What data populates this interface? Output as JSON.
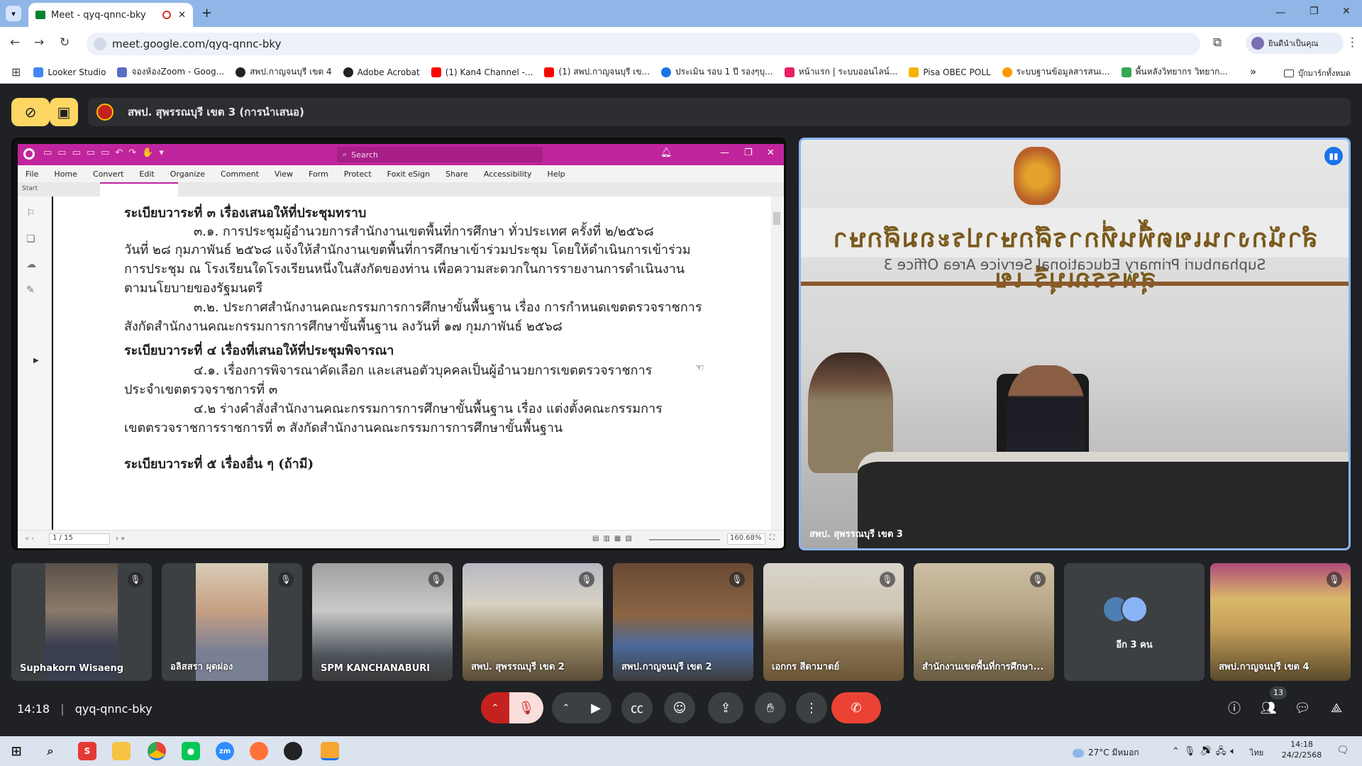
{
  "browser": {
    "tab_title": "Meet - qyq-qnnc-bky",
    "new_tab": "+",
    "url": "meet.google.com/qyq-qnnc-bky",
    "profile_label": "ยินดีนำเป็นคุณ",
    "bookmarks": [
      "Looker Studio",
      "จองห้องZoom - Goog...",
      "สพป.กาญจนบุรี เขต 4",
      "Adobe Acrobat",
      "(1) Kan4 Channel -...",
      "(1) สพป.กาญจนบุรี เข...",
      "ประเมิน รอบ 1 ปี รองๆบุ...",
      "หน้าแรก | ระบบออนไลน์...",
      "Pisa OBEC POLL",
      "ระบบฐานข้อมูลสารสนเ...",
      "พื้นหลังวิทยากร วิทยาก..."
    ],
    "bookmarks_more": "»",
    "other_bookmarks": "บุ๊กมาร์กทั้งหมด"
  },
  "meet": {
    "presenter_title": "สพป. สุพรรณบุรี เขต 3 (การนำเสนอ)",
    "speaker_name": "สพป. สุพรรณบุรี เขต 3",
    "sign_text": "สำนักงานเขตพื้นที่การศึกษาประถมศึกษาสุพรรณบุรี เข",
    "sign_sub": "Suphanburi Primary Educational Service Area Office 3",
    "participants": [
      "Suphakorn Wisaeng",
      "อลิสสรา ผุดผ่อง",
      "SPM KANCHANABURI",
      "สพป. สุพรรณบุรี เขต 2",
      "สพป.กาญจนบุรี เขต 2",
      "เอกกร สีดามาตย์",
      "สำนักงานเขตพื้นที่การศึกษา...",
      "อีก 3 คน",
      "สพป.กาญจนบุรี เขต 4"
    ],
    "time": "14:18",
    "meeting_code": "qyq-qnnc-bky",
    "people_count": "13"
  },
  "foxit": {
    "search_placeholder": "Search",
    "menu": [
      "File",
      "Home",
      "Convert",
      "Edit",
      "Organize",
      "Comment",
      "View",
      "Form",
      "Protect",
      "Foxit eSign",
      "Share",
      "Accessibility",
      "Help"
    ],
    "tab_start": "Start",
    "page": "1 / 15",
    "zoom": "160.68%",
    "doc_lines": [
      "ระเบียบวาระที่ ๓ เรื่องเสนอให้ที่ประชุมทราบ",
      "๓.๑. การประชุมผู้อำนวยการสำนักงานเขตพื้นที่การศึกษา ทั่วประเทศ ครั้งที่ ๒/๒๕๖๘",
      "วันที่ ๒๘ กุมภาพันธ์ ๒๕๖๘ แจ้งให้สำนักงานเขตพื้นที่การศึกษาเข้าร่วมประชุม โดยให้ดำเนินการเข้าร่วม",
      "การประชุม ณ โรงเรียนใดโรงเรียนหนึ่งในสังกัดของท่าน เพื่อความสะดวกในการรายงานการดำเนินงาน",
      "ตามนโยบายของรัฐมนตรี",
      "๓.๒. ประกาศสำนักงานคณะกรรมการการศึกษาขั้นพื้นฐาน เรื่อง การกำหนดเขตตรวจราชการ",
      "สังกัดสำนักงานคณะกรรมการการศึกษาขั้นพื้นฐาน ลงวันที่ ๑๗ กุมภาพันธ์ ๒๕๖๘",
      "ระเบียบวาระที่ ๔ เรื่องที่เสนอให้ที่ประชุมพิจารณา",
      "๔.๑. เรื่องการพิจารณาคัดเลือก และเสนอตัวบุคคลเป็นผู้อำนวยการเขตตรวจราชการ",
      "ประจำเขตตรวจราชการที่ ๓",
      "๔.๒ ร่างคำสั่งสำนักงานคณะกรรมการการศึกษาขั้นพื้นฐาน เรื่อง แต่งตั้งคณะกรรมการ",
      "เขตตรวจราชการราชการที่ ๓ สังกัดสำนักงานคณะกรรมการการศึกษาขั้นพื้นฐาน",
      "ระเบียบวาระที่ ๕ เรื่องอื่น ๆ (ถ้ามี)"
    ]
  },
  "taskbar": {
    "weather": "27°C มีหมอก",
    "lang": "ไทย",
    "clock_time": "14:18",
    "clock_date": "24/2/2568"
  },
  "colors": {
    "end_call": "#ea4335",
    "foxit": "#c0259d",
    "accent": "#8ab4f8",
    "mute_active": "#f9dedc"
  }
}
